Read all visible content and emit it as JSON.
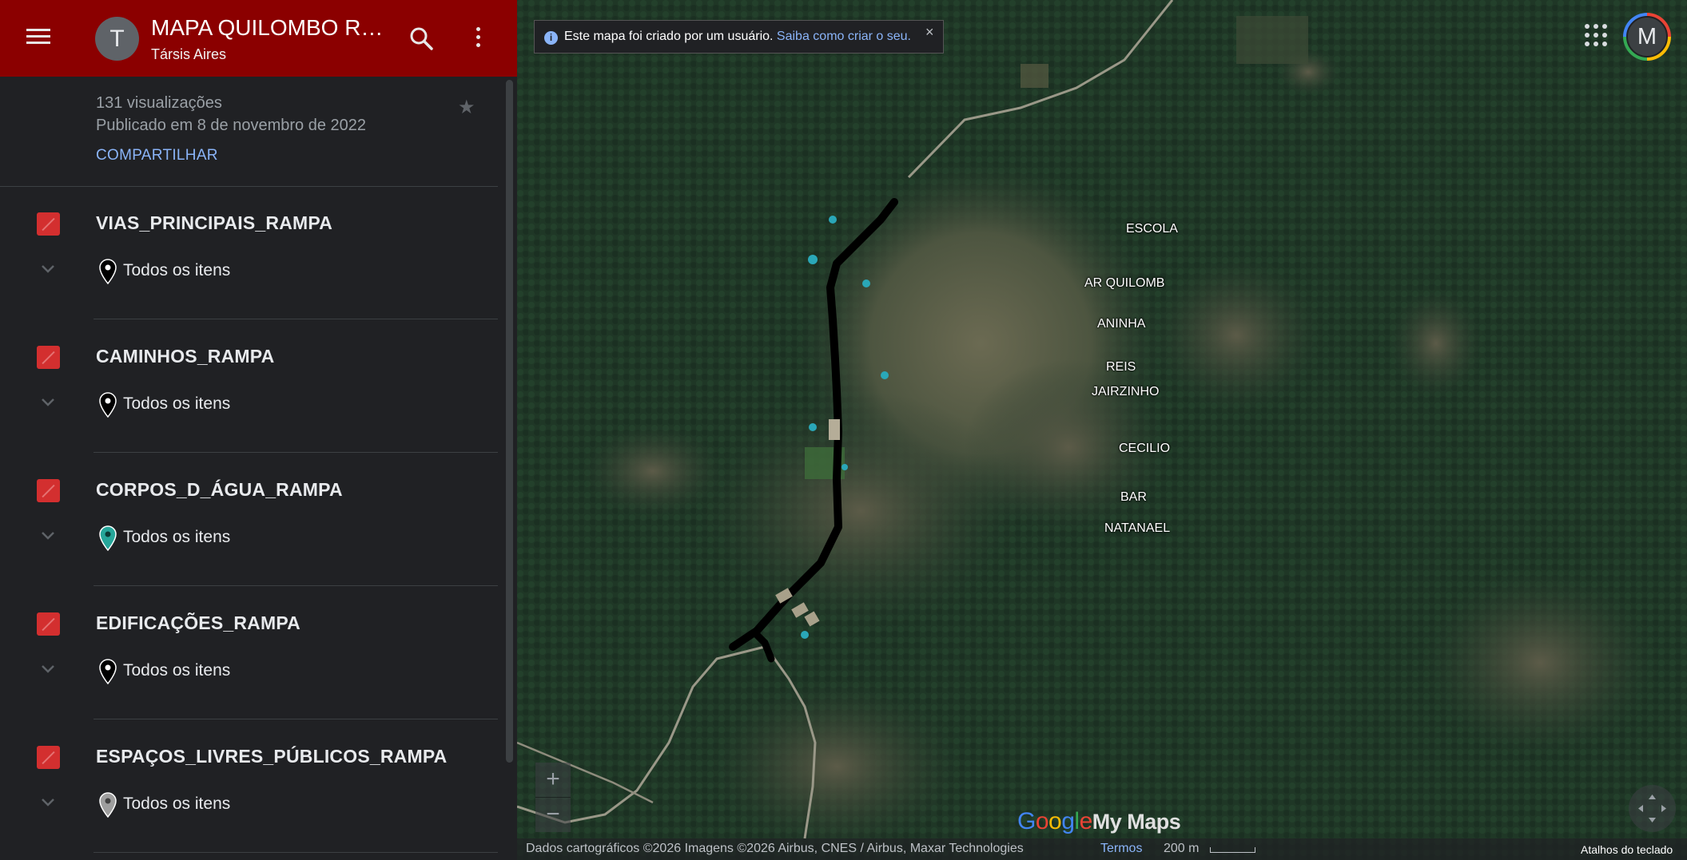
{
  "header": {
    "title": "MAPA QUILOMBO RA...",
    "author": "Társis Aires",
    "avatar_letter": "T",
    "menu_icon": "hamburger-menu-icon",
    "search_icon": "search-icon",
    "more_icon": "more-vert-icon",
    "bg_color": "#8b0000"
  },
  "meta": {
    "views": "131 visualizações",
    "published": "Publicado em 8 de novembro de 2022",
    "share_label": "COMPARTILHAR",
    "star_icon": "star-icon"
  },
  "layers": [
    {
      "name": "VIAS_PRINCIPAIS_RAMPA",
      "items_label": "Todos os itens",
      "pin_color": "#000000",
      "checked": true
    },
    {
      "name": "CAMINHOS_RAMPA",
      "items_label": "Todos os itens",
      "pin_color": "#000000",
      "checked": true
    },
    {
      "name": "CORPOS_D_ÁGUA_RAMPA",
      "items_label": "Todos os itens",
      "pin_color": "#26a69a",
      "checked": true
    },
    {
      "name": "EDIFICAÇÕES_RAMPA",
      "items_label": "Todos os itens",
      "pin_color": "#000000",
      "checked": true
    },
    {
      "name": "ESPAÇOS_LIVRES_PÚBLICOS_RAMPA",
      "items_label": "Todos os itens",
      "pin_color": "#9e9e9e",
      "checked": true
    }
  ],
  "map": {
    "info_text": "Este mapa foi criado por um usuário.",
    "info_link": "Saiba como criar o seu.",
    "info_close": "×",
    "account_letter": "M",
    "labels": [
      "ESCOLA",
      "AR QUILOMB",
      "ANINHA",
      "REIS",
      "JAIRZINHO",
      "CECILIO",
      "BAR",
      "NATANAEL"
    ],
    "zoom_in": "+",
    "zoom_out": "−",
    "logo_google": "Google",
    "logo_mymaps": "My Maps",
    "attribution": "Dados cartográficos ©2026 Imagens ©2026 Airbus, CNES / Airbus, Maxar Technologies",
    "terms": "Termos",
    "scale": "200 m",
    "keyboard_shortcuts": "Atalhos do teclado"
  }
}
